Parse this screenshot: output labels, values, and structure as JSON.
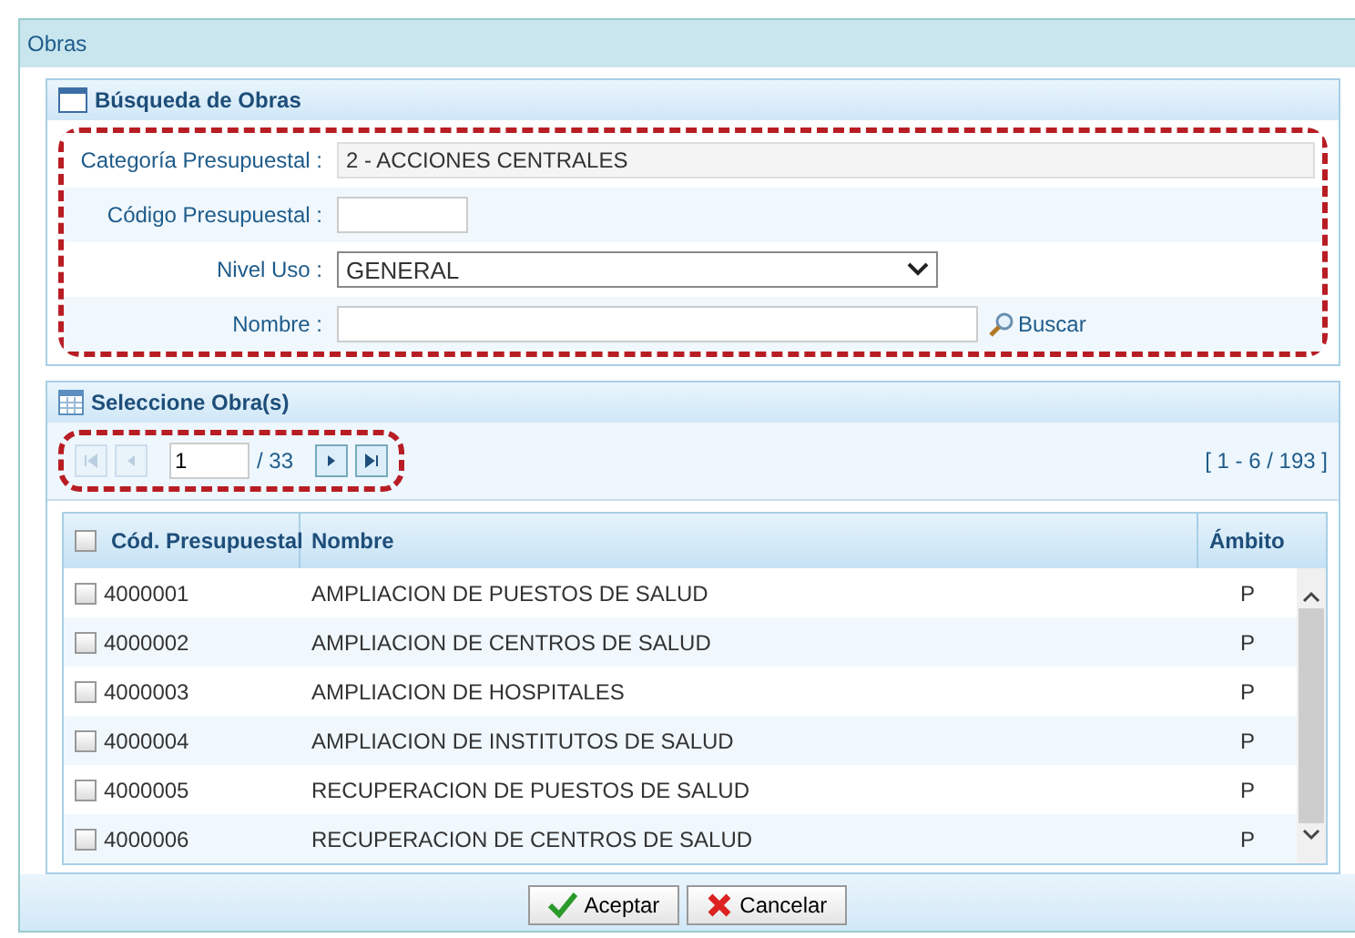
{
  "window": {
    "title": "Obras"
  },
  "search_panel": {
    "title": "Búsqueda de Obras",
    "highlighted": true,
    "fields": [
      {
        "kind": "readonly",
        "label": "Categoría Presupuestal :",
        "value": "2 - ACCIONES CENTRALES"
      },
      {
        "kind": "text",
        "label": "Código Presupuestal :"
      },
      {
        "kind": "select",
        "label": "Nivel Uso :",
        "value": "GENERAL"
      },
      {
        "kind": "search",
        "label": "Nombre :",
        "action": "Buscar"
      }
    ]
  },
  "results_panel": {
    "title": "Seleccione Obra(s)",
    "pager": {
      "highlighted": true,
      "page": "1",
      "total": "/ 33",
      "range": "[ 1 - 6 / 193 ]",
      "first_disabled": true,
      "prev_disabled": true,
      "next_disabled": false,
      "last_disabled": false
    },
    "table": {
      "columns": [
        "Cód. Presupuestal",
        "Nombre",
        "Ámbito"
      ],
      "select_all_checked": false,
      "rows": [
        {
          "code": "4000001",
          "name": "AMPLIACION DE PUESTOS DE SALUD",
          "scope": "P",
          "checked": false
        },
        {
          "code": "4000002",
          "name": "AMPLIACION DE CENTROS DE SALUD",
          "scope": "P",
          "checked": false
        },
        {
          "code": "4000003",
          "name": "AMPLIACION DE HOSPITALES",
          "scope": "P",
          "checked": false
        },
        {
          "code": "4000004",
          "name": "AMPLIACION DE INSTITUTOS DE SALUD",
          "scope": "P",
          "checked": false
        },
        {
          "code": "4000005",
          "name": "RECUPERACION DE PUESTOS DE SALUD",
          "scope": "P",
          "checked": false
        },
        {
          "code": "4000006",
          "name": "RECUPERACION DE CENTROS DE SALUD",
          "scope": "P",
          "checked": false
        }
      ]
    }
  },
  "buttons": [
    {
      "kind": "ok",
      "label": "Aceptar"
    },
    {
      "kind": "cancel",
      "label": "Cancelar"
    }
  ]
}
